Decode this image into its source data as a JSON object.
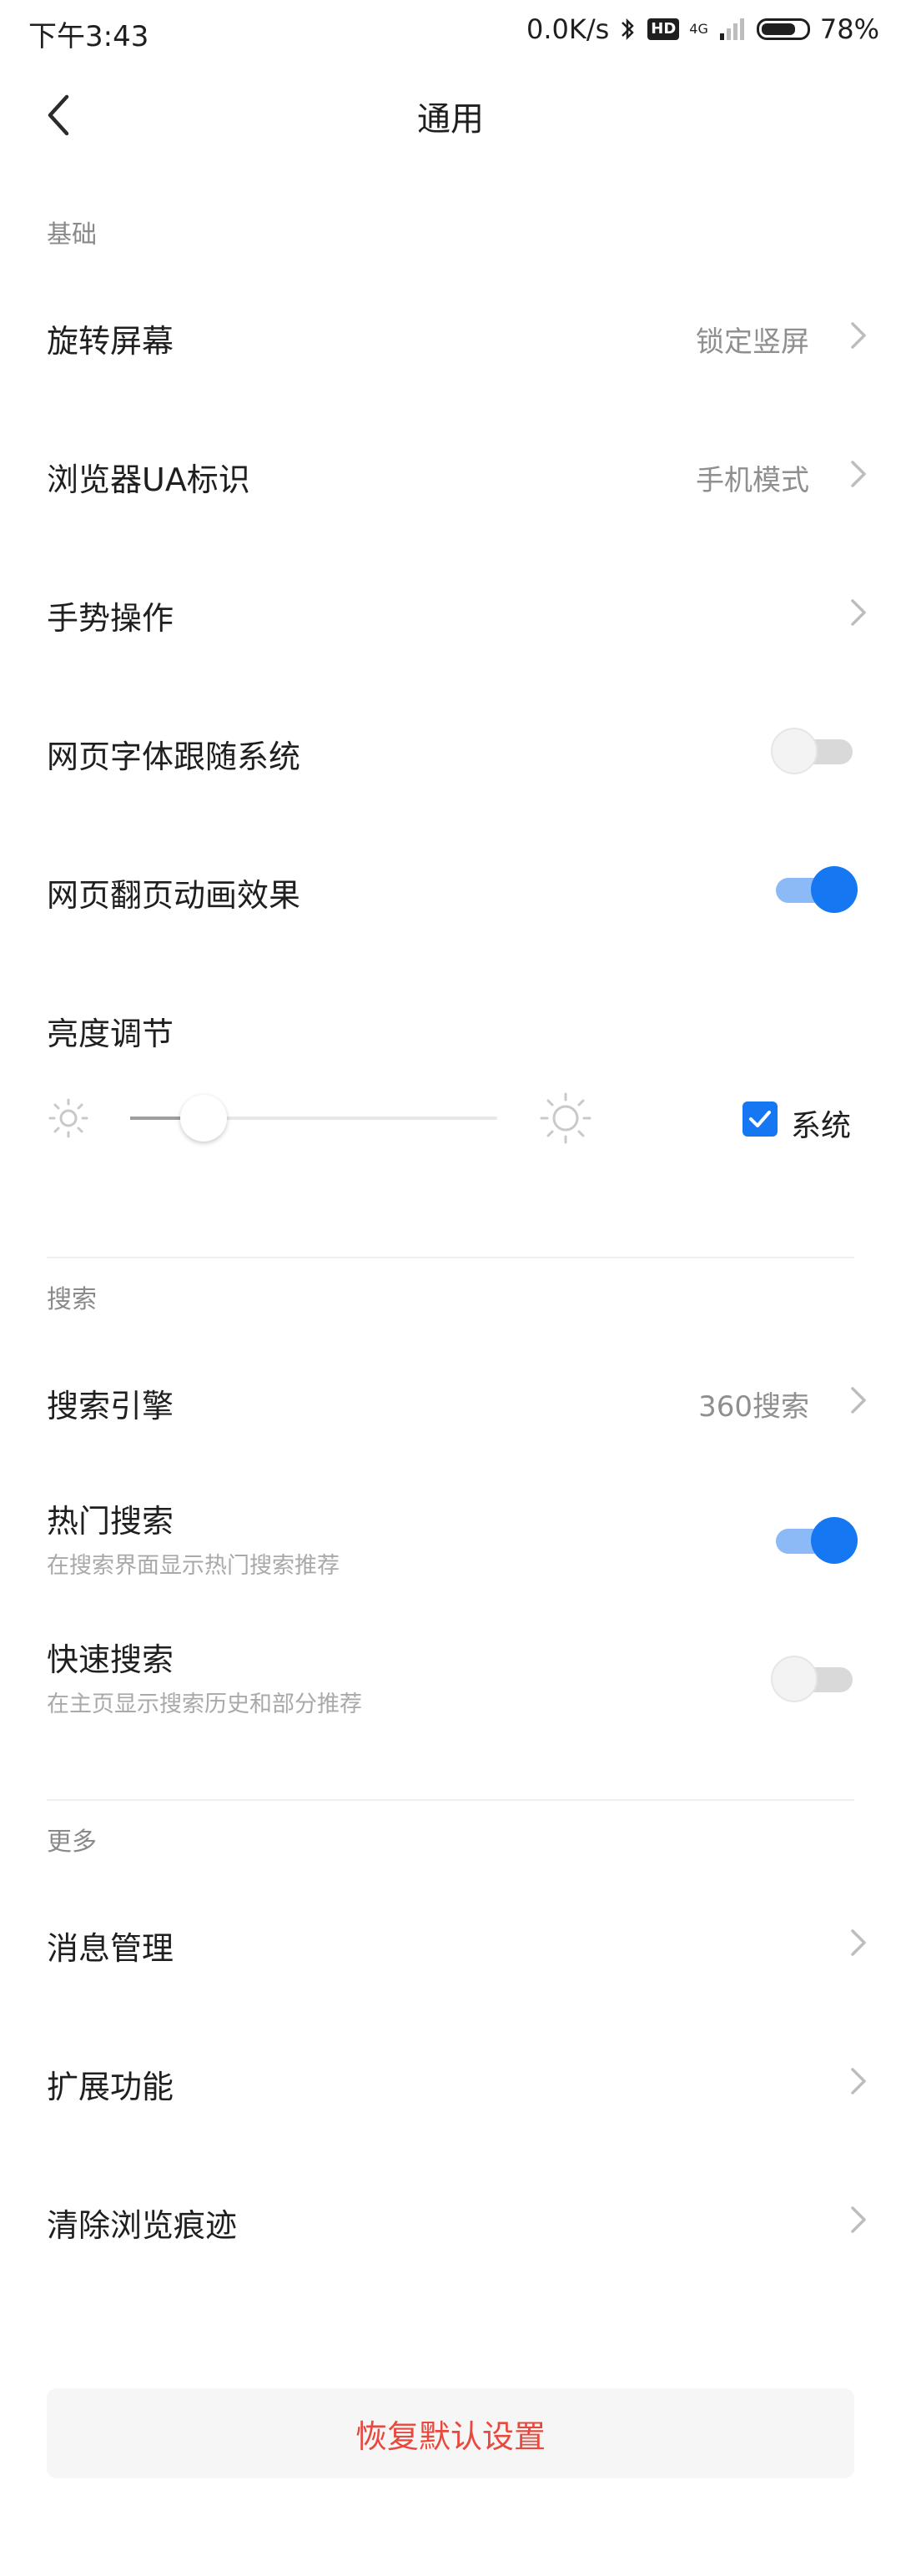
{
  "status_bar": {
    "time": "下午3:43",
    "net_speed": "0.0K/s",
    "hd": "HD",
    "network": "4G",
    "battery": "78%"
  },
  "header": {
    "title": "通用"
  },
  "sections": {
    "basic": "基础",
    "search": "搜索",
    "more": "更多"
  },
  "basic": {
    "rotate": {
      "label": "旋转屏幕",
      "value": "锁定竖屏"
    },
    "ua": {
      "label": "浏览器UA标识",
      "value": "手机模式"
    },
    "gesture": {
      "label": "手势操作"
    },
    "font_follow": {
      "label": "网页字体跟随系统",
      "on": false
    },
    "page_anim": {
      "label": "网页翻页动画效果",
      "on": true
    },
    "brightness": {
      "label": "亮度调节",
      "level": 0.2,
      "system_checked": true,
      "system_label": "系统"
    }
  },
  "search": {
    "engine": {
      "label": "搜索引擎",
      "value": "360搜索"
    },
    "hot": {
      "label": "热门搜索",
      "sub": "在搜索界面显示热门搜索推荐",
      "on": true
    },
    "quick": {
      "label": "快速搜索",
      "sub": "在主页显示搜索历史和部分推荐",
      "on": false
    }
  },
  "more": {
    "messages": {
      "label": "消息管理"
    },
    "extensions": {
      "label": "扩展功能"
    },
    "clear": {
      "label": "清除浏览痕迹"
    }
  },
  "reset_label": "恢复默认设置",
  "colors": {
    "accent": "#1677f2",
    "danger": "#e8483d"
  },
  "icons": {
    "back": "back-icon",
    "chevron": "chevron-right-icon",
    "sun_small": "brightness-low-icon",
    "sun_large": "brightness-high-icon",
    "check": "check-icon"
  }
}
